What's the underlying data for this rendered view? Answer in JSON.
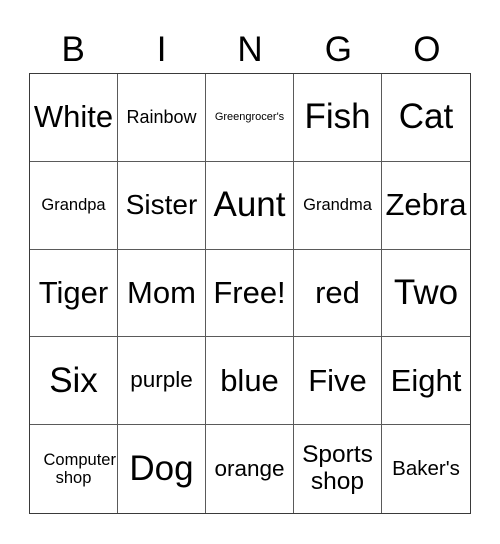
{
  "card": {
    "header": [
      "B",
      "I",
      "N",
      "G",
      "O"
    ],
    "cells": [
      {
        "text": "White",
        "size": "xl"
      },
      {
        "text": "Rainbow",
        "size": "s"
      },
      {
        "text": "Greengrocer's",
        "size": "xxs"
      },
      {
        "text": "Fish",
        "size": "xxl"
      },
      {
        "text": "Cat",
        "size": "xxl"
      },
      {
        "text": "Grandpa",
        "size": "xs"
      },
      {
        "text": "Sister",
        "size": "l"
      },
      {
        "text": "Aunt",
        "size": "xxl"
      },
      {
        "text": "Grandma",
        "size": "xs"
      },
      {
        "text": "Zebra",
        "size": "xl"
      },
      {
        "text": "Tiger",
        "size": "xl"
      },
      {
        "text": "Mom",
        "size": "xl"
      },
      {
        "text": "Free!",
        "size": "xl"
      },
      {
        "text": "red",
        "size": "xl"
      },
      {
        "text": "Two",
        "size": "xxl"
      },
      {
        "text": "Six",
        "size": "xxl"
      },
      {
        "text": "purple",
        "size": "m"
      },
      {
        "text": "blue",
        "size": "xl"
      },
      {
        "text": "Five",
        "size": "xl"
      },
      {
        "text": "Eight",
        "size": "xl"
      },
      {
        "text": "Computer shop",
        "size": "xs"
      },
      {
        "text": "Dog",
        "size": "xxl"
      },
      {
        "text": "orange",
        "size": "m"
      },
      {
        "text": "Sports shop",
        "size": "l2"
      },
      {
        "text": "Baker's",
        "size": "s2"
      }
    ]
  }
}
